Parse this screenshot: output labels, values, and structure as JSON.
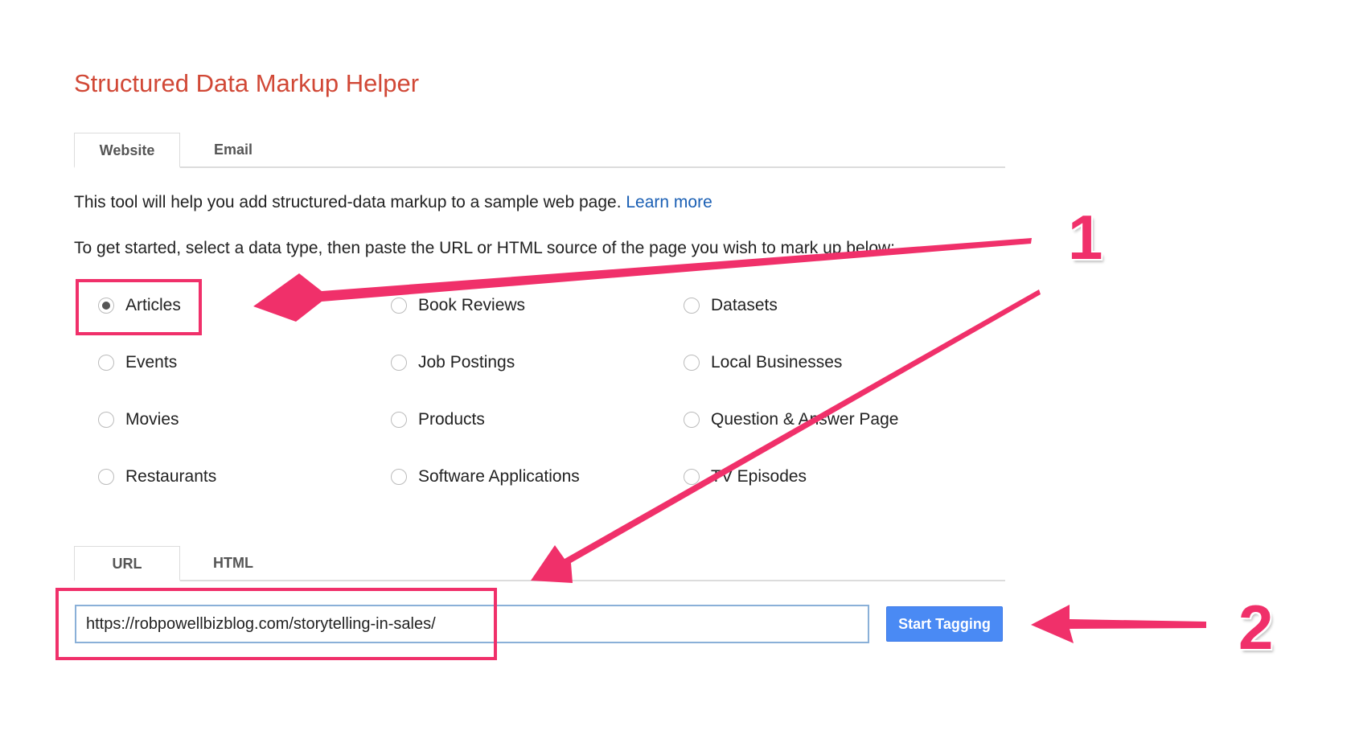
{
  "title": "Structured Data Markup Helper",
  "top_tabs": [
    {
      "label": "Website",
      "active": true
    },
    {
      "label": "Email",
      "active": false
    }
  ],
  "intro": {
    "text": "This tool will help you add structured-data markup to a sample web page.",
    "link": "Learn more"
  },
  "instructions": "To get started, select a data type, then paste the URL or HTML source of the page you wish to mark up below:",
  "data_types": [
    {
      "label": "Articles",
      "selected": true
    },
    {
      "label": "Book Reviews",
      "selected": false
    },
    {
      "label": "Datasets",
      "selected": false
    },
    {
      "label": "Events",
      "selected": false
    },
    {
      "label": "Job Postings",
      "selected": false
    },
    {
      "label": "Local Businesses",
      "selected": false
    },
    {
      "label": "Movies",
      "selected": false
    },
    {
      "label": "Products",
      "selected": false
    },
    {
      "label": "Question & Answer Page",
      "selected": false
    },
    {
      "label": "Restaurants",
      "selected": false
    },
    {
      "label": "Software Applications",
      "selected": false
    },
    {
      "label": "TV Episodes",
      "selected": false
    }
  ],
  "source_tabs": [
    {
      "label": "URL",
      "active": true
    },
    {
      "label": "HTML",
      "active": false
    }
  ],
  "url_input": {
    "value": "https://robpowellbizblog.com/storytelling-in-sales/"
  },
  "start_button": "Start Tagging",
  "annotations": {
    "step1": "1",
    "step2": "2",
    "color": "#f0306a"
  },
  "colors": {
    "title": "#d14836",
    "link": "#1a5fb4",
    "button": "#4a8af4"
  }
}
